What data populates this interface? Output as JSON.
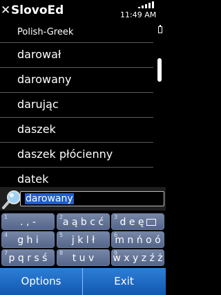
{
  "header": {
    "app_title": "SlovoEd",
    "close_glyph": "✕",
    "time": "11:49 AM"
  },
  "dictionary": {
    "name": "Polish-Greek"
  },
  "list": {
    "items": [
      {
        "label": "darował"
      },
      {
        "label": "darowany"
      },
      {
        "label": "darując"
      },
      {
        "label": "daszek"
      },
      {
        "label": "daszek płócienny"
      },
      {
        "label": "datek"
      }
    ],
    "scroll_fraction": 0.14
  },
  "search": {
    "value": "darowany"
  },
  "keypad": {
    "keys": [
      {
        "num": "1",
        "label": ". , -"
      },
      {
        "num": "2",
        "label": "a ą b c ć"
      },
      {
        "num": "3",
        "label": "d e ę"
      },
      {
        "num": "4",
        "label": "g h i"
      },
      {
        "num": "5",
        "label": "j k l ł"
      },
      {
        "num": "6",
        "label": "m n ń o ó"
      },
      {
        "num": "7",
        "label": "p q r s ś"
      },
      {
        "num": "8",
        "label": "t u v"
      },
      {
        "num": "9",
        "label": "w x y z ź ż"
      }
    ]
  },
  "softkeys": {
    "left": "Options",
    "right": "Exit"
  },
  "colors": {
    "background": "#000000",
    "key": "#6677a0",
    "softkey_bar": "#1f6cc4",
    "selection": "#1f5dcc"
  }
}
